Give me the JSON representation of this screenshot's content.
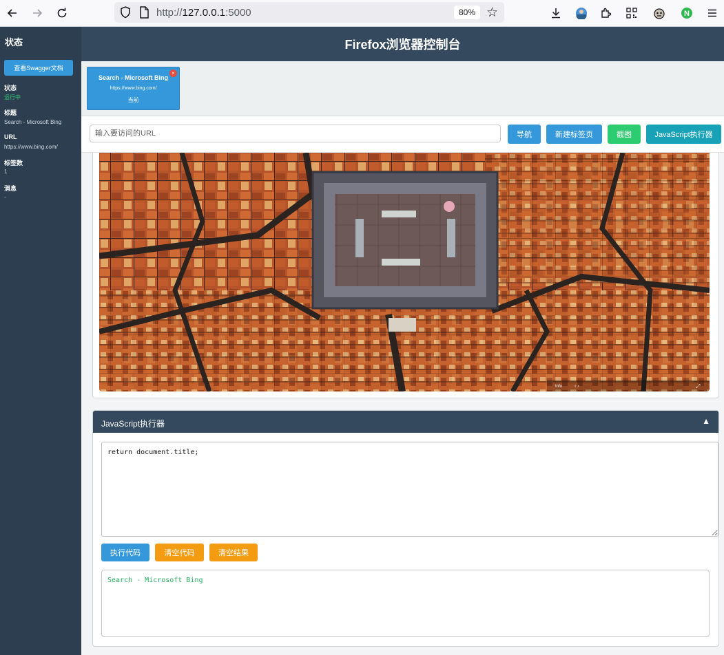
{
  "browser": {
    "url_prefix": "http://",
    "url_host": "127.0.0.1",
    "url_port": ":5000",
    "zoom": "80%"
  },
  "sidebar": {
    "title": "状态",
    "swagger_button": "查看Swagger文档",
    "fields": [
      {
        "label": "状态",
        "value": "运行中"
      },
      {
        "label": "标题",
        "value": "Search - Microsoft Bing"
      },
      {
        "label": "URL",
        "value": "https://www.bing.com/"
      },
      {
        "label": "标签数",
        "value": "1"
      },
      {
        "label": "消息",
        "value": "-"
      }
    ]
  },
  "header": {
    "title": "Firefox浏览器控制台"
  },
  "tabs": [
    {
      "title": "Search - Microsoft Bing",
      "url": "https://www.bing.com/",
      "status": "当前",
      "close": "×"
    }
  ],
  "toolbar": {
    "url_placeholder": "输入要访问的URL",
    "navigate": "导航",
    "new_tab": "新建标签页",
    "screenshot": "截图",
    "js_executor": "JavaScript执行器"
  },
  "screenshot_overlay": {
    "info": "Info"
  },
  "js_panel": {
    "title": "JavaScript执行器",
    "toggle": "▲",
    "code": "return document.title;",
    "run": "执行代码",
    "clear_code": "清空代码",
    "clear_result": "清空结果",
    "result": "Search - Microsoft Bing"
  },
  "colors": {
    "sidebar_bg": "#2c3e50",
    "header_bg": "#34495e",
    "primary": "#3498db",
    "success": "#2ecc71",
    "warning": "#f39c12",
    "teal": "#17a2b8"
  }
}
